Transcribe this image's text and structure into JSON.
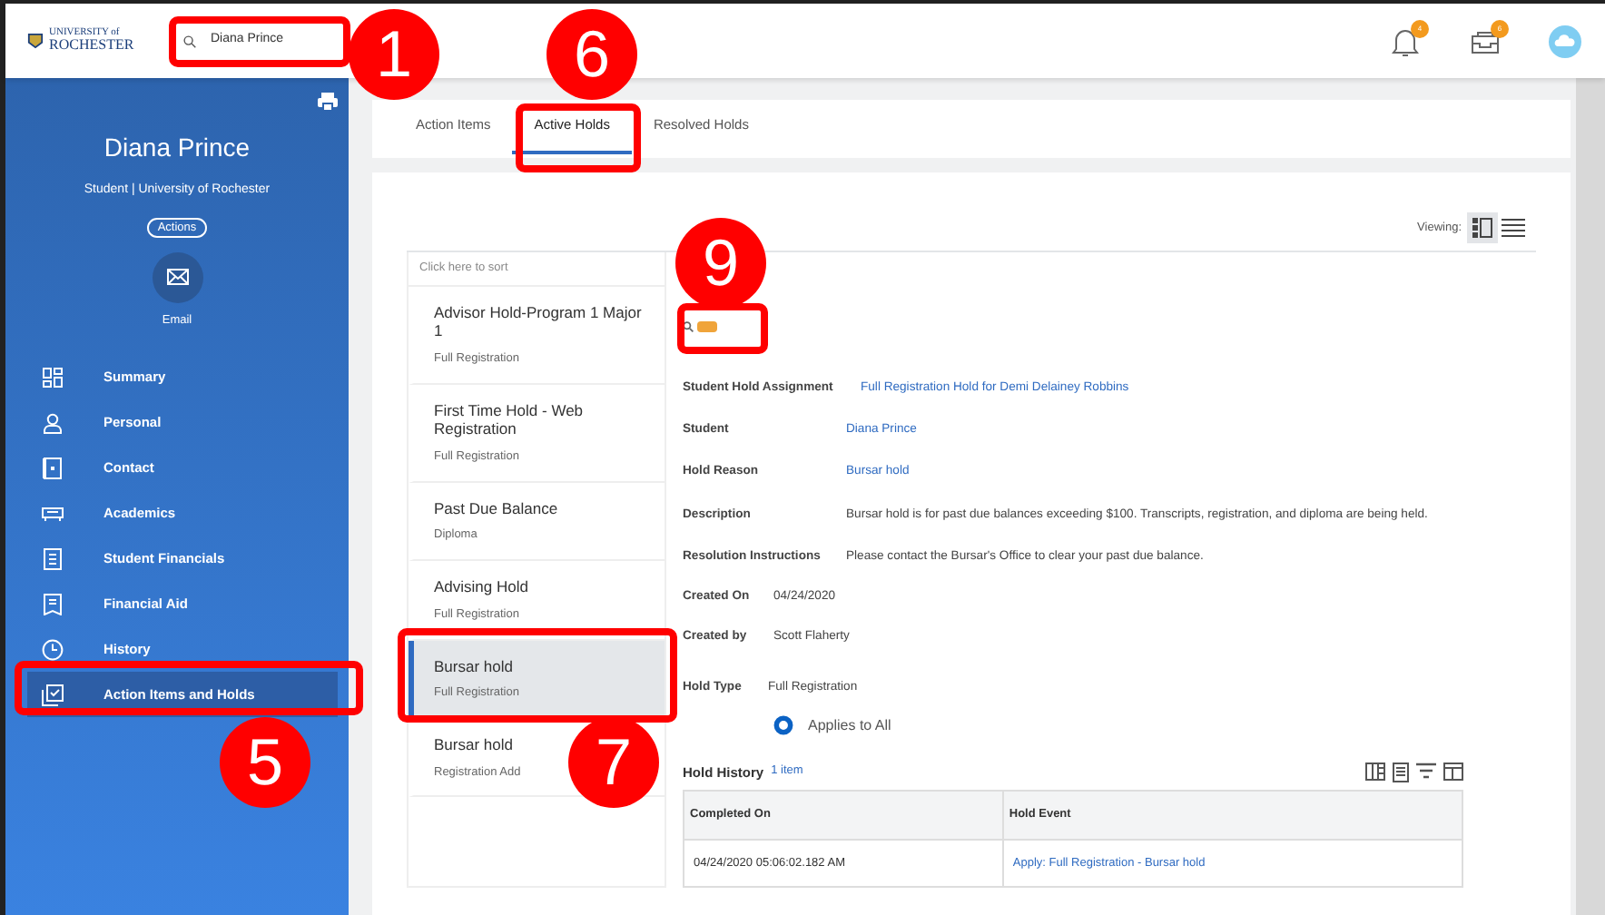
{
  "logo": {
    "small": "UNIVERSITY of",
    "name": "ROCHESTER"
  },
  "search": {
    "value": "Diana Prince"
  },
  "header_icons": [
    {
      "kind": "bell",
      "badge": "4"
    },
    {
      "kind": "inbox",
      "badge": "6"
    },
    {
      "kind": "cloud"
    }
  ],
  "profile": {
    "name": "Diana Prince",
    "subtitle": "Student | University of Rochester",
    "actions": "Actions",
    "email": "Email"
  },
  "sidebar": {
    "items": [
      {
        "label": "Summary",
        "selected": false
      },
      {
        "label": "Personal",
        "selected": false
      },
      {
        "label": "Contact",
        "selected": false
      },
      {
        "label": "Academics",
        "selected": false
      },
      {
        "label": "Student Financials",
        "selected": false
      },
      {
        "label": "Financial Aid",
        "selected": false
      },
      {
        "label": "History",
        "selected": false
      },
      {
        "label": "Action Items and Holds",
        "selected": true
      }
    ]
  },
  "tabs": [
    {
      "label": "Action Items",
      "selected": false
    },
    {
      "label": "Active Holds",
      "selected": true
    },
    {
      "label": "Resolved Holds",
      "selected": false
    }
  ],
  "viewing": {
    "label": "Viewing:",
    "modes": [
      {
        "kind": "split",
        "selected": true
      },
      {
        "kind": "list",
        "selected": false
      }
    ]
  },
  "holds": {
    "sort_hint": "Click here to sort",
    "items": [
      {
        "title": "Advisor Hold-Program 1 Major 1",
        "subtitle": "Full Registration",
        "selected": false
      },
      {
        "title": "First Time Hold - Web Registration",
        "subtitle": "Full Registration",
        "selected": false
      },
      {
        "title": "Past Due Balance",
        "subtitle": "Diploma",
        "selected": false
      },
      {
        "title": "Advising Hold",
        "subtitle": "Full Registration",
        "selected": false
      },
      {
        "title": "Bursar hold",
        "subtitle": "Full Registration",
        "selected": true
      },
      {
        "title": "Bursar hold",
        "subtitle": "Registration Add",
        "selected": false
      }
    ]
  },
  "detail": {
    "assignment": {
      "label": "Student Hold Assignment",
      "value": "Full Registration Hold for Demi Delainey Robbins"
    },
    "fields": [
      {
        "label": "Student",
        "value": "Diana Prince",
        "kind": "link"
      },
      {
        "label": "Hold Reason",
        "value": "Bursar hold",
        "kind": "link"
      },
      {
        "label": "Description",
        "value": "Bursar hold is for past due balances exceeding $100. Transcripts, registration, and diploma are being held.",
        "kind": "text"
      },
      {
        "label": "Resolution Instructions",
        "value": "Please contact the Bursar's Office to clear your past due balance.",
        "kind": "text"
      }
    ],
    "created": [
      {
        "label": "Created On",
        "value": "04/24/2020"
      },
      {
        "label": "Created by",
        "value": "Scott Flaherty"
      }
    ],
    "hold_type": {
      "label": "Hold Type",
      "value": "Full Registration",
      "option": "Applies to All",
      "checked": true
    }
  },
  "history": {
    "title": "Hold History",
    "count": "1 item",
    "columns": [
      "Completed On",
      "Hold Event"
    ],
    "rows": [
      [
        "04/24/2020 05:06:02.182 AM",
        "Apply: Full Registration - Bursar hold"
      ]
    ]
  },
  "callouts": [
    {
      "number": "1"
    },
    {
      "number": "6"
    },
    {
      "number": "9"
    },
    {
      "number": "5"
    },
    {
      "number": "7"
    }
  ]
}
